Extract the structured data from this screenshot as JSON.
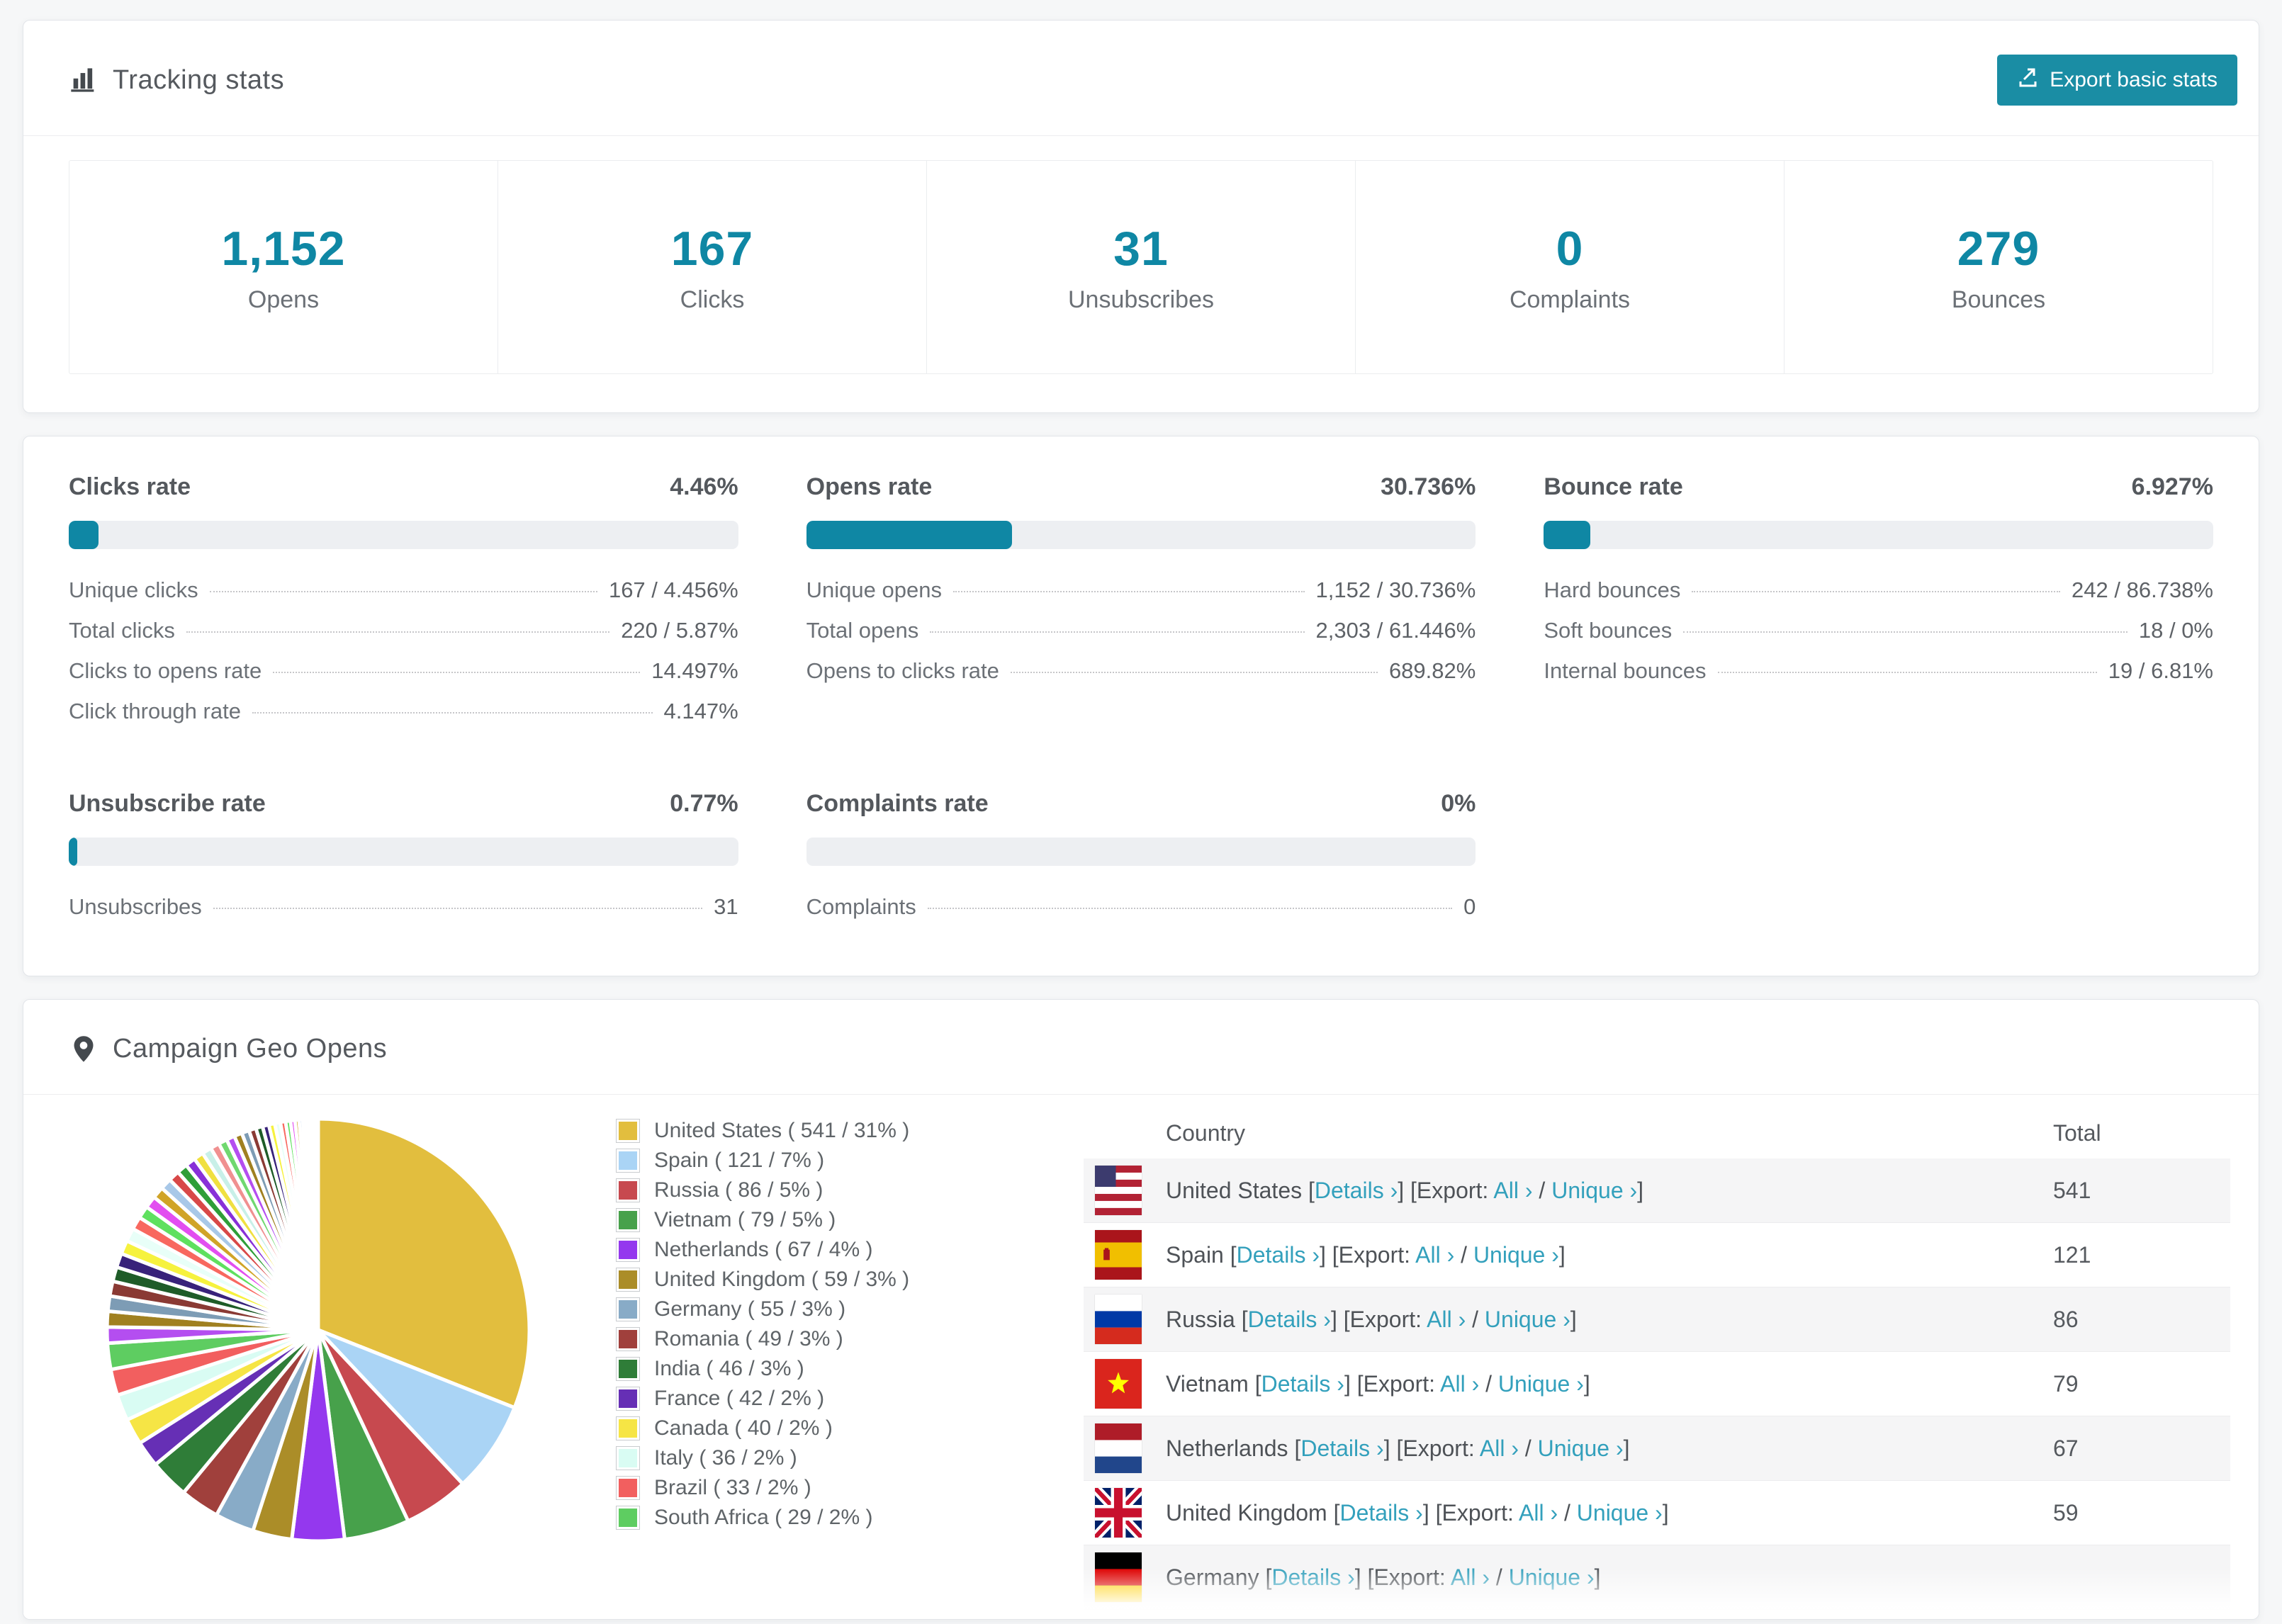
{
  "colors": {
    "accent_teal": "#0f87a4",
    "button_teal": "#1a8da4",
    "link_teal": "#33a0bc",
    "page_bg": "#f6f7f8",
    "track_gray": "#edeff2",
    "row_stripe": "#f5f5f6"
  },
  "tracking": {
    "title": "Tracking stats",
    "export_label": "Export basic stats",
    "stats": [
      {
        "value": "1,152",
        "label": "Opens"
      },
      {
        "value": "167",
        "label": "Clicks"
      },
      {
        "value": "31",
        "label": "Unsubscribes"
      },
      {
        "value": "0",
        "label": "Complaints"
      },
      {
        "value": "279",
        "label": "Bounces"
      }
    ]
  },
  "rates": {
    "sections": [
      {
        "title": "Clicks rate",
        "value": "4.46%",
        "percent": 4.46,
        "rows": [
          {
            "label": "Unique clicks",
            "value": "167 / 4.456%"
          },
          {
            "label": "Total clicks",
            "value": "220 / 5.87%"
          },
          {
            "label": "Clicks to opens rate",
            "value": "14.497%"
          },
          {
            "label": "Click through rate",
            "value": "4.147%"
          }
        ]
      },
      {
        "title": "Opens rate",
        "value": "30.736%",
        "percent": 30.736,
        "rows": [
          {
            "label": "Unique opens",
            "value": "1,152 / 30.736%"
          },
          {
            "label": "Total opens",
            "value": "2,303 / 61.446%"
          },
          {
            "label": "Opens to clicks rate",
            "value": "689.82%"
          }
        ]
      },
      {
        "title": "Bounce rate",
        "value": "6.927%",
        "percent": 6.927,
        "rows": [
          {
            "label": "Hard bounces",
            "value": "242 / 86.738%"
          },
          {
            "label": "Soft bounces",
            "value": "18 / 0%"
          },
          {
            "label": "Internal bounces",
            "value": "19 / 6.81%"
          }
        ]
      },
      {
        "title": "Unsubscribe rate",
        "value": "0.77%",
        "percent": 0.77,
        "rows": [
          {
            "label": "Unsubscribes",
            "value": "31"
          }
        ]
      },
      {
        "title": "Complaints rate",
        "value": "0%",
        "percent": 0,
        "rows": [
          {
            "label": "Complaints",
            "value": "0"
          }
        ]
      }
    ]
  },
  "geo": {
    "title": "Campaign Geo Opens",
    "legend": [
      {
        "label": "United States ( 541 / 31% )",
        "color": "#e2be3e"
      },
      {
        "label": "Spain ( 121 / 7% )",
        "color": "#aad4f5"
      },
      {
        "label": "Russia ( 86 / 5% )",
        "color": "#c7494f"
      },
      {
        "label": "Vietnam ( 79 / 5% )",
        "color": "#47a14b"
      },
      {
        "label": "Netherlands ( 67 / 4% )",
        "color": "#9438ee"
      },
      {
        "label": "United Kingdom ( 59 / 3% )",
        "color": "#ab8d28"
      },
      {
        "label": "Germany ( 55 / 3% )",
        "color": "#88abc7"
      },
      {
        "label": "Romania ( 49 / 3% )",
        "color": "#a0403c"
      },
      {
        "label": "India ( 46 / 3% )",
        "color": "#2f7d38"
      },
      {
        "label": "France ( 42 / 2% )",
        "color": "#662fb5"
      },
      {
        "label": "Canada ( 40 / 2% )",
        "color": "#f6e545"
      },
      {
        "label": "Italy ( 36 / 2% )",
        "color": "#d9fcf3"
      },
      {
        "label": "Brazil ( 33 / 2% )",
        "color": "#f25f5f"
      },
      {
        "label": "South Africa ( 29 / 2% )",
        "color": "#5ecd61"
      }
    ],
    "table": {
      "col_country": "Country",
      "col_total": "Total",
      "links": {
        "bracket_open": "[",
        "bracket_close": "]",
        "details": "Details ›",
        "export_prefix": "[Export:",
        "all": "All ›",
        "slash": "/",
        "unique": "Unique ›"
      },
      "rows": [
        {
          "flag": "us",
          "country": "United States",
          "total": "541",
          "partial": false
        },
        {
          "flag": "es",
          "country": "Spain",
          "total": "121",
          "partial": false
        },
        {
          "flag": "ru",
          "country": "Russia",
          "total": "86",
          "partial": false
        },
        {
          "flag": "vn",
          "country": "Vietnam",
          "total": "79",
          "partial": false
        },
        {
          "flag": "nl",
          "country": "Netherlands",
          "total": "67",
          "partial": false
        },
        {
          "flag": "gb",
          "country": "United Kingdom",
          "total": "59",
          "partial": false
        },
        {
          "flag": "de",
          "country": "Germany",
          "total": "",
          "partial": true
        }
      ]
    }
  },
  "chart_data": {
    "type": "pie",
    "title": "Campaign Geo Opens",
    "legend_position": "right",
    "start_angle_deg": -90,
    "direction": "clockwise",
    "slices": [
      {
        "label": "United States",
        "value": 541,
        "pct": 31,
        "color": "#e2be3e"
      },
      {
        "label": "Spain",
        "value": 121,
        "pct": 7,
        "color": "#aad4f5"
      },
      {
        "label": "Russia",
        "value": 86,
        "pct": 5,
        "color": "#c7494f"
      },
      {
        "label": "Vietnam",
        "value": 79,
        "pct": 5,
        "color": "#47a14b"
      },
      {
        "label": "Netherlands",
        "value": 67,
        "pct": 4,
        "color": "#9438ee"
      },
      {
        "label": "United Kingdom",
        "value": 59,
        "pct": 3,
        "color": "#ab8d28"
      },
      {
        "label": "Germany",
        "value": 55,
        "pct": 3,
        "color": "#88abc7"
      },
      {
        "label": "Romania",
        "value": 49,
        "pct": 3,
        "color": "#a0403c"
      },
      {
        "label": "India",
        "value": 46,
        "pct": 3,
        "color": "#2f7d38"
      },
      {
        "label": "France",
        "value": 42,
        "pct": 2,
        "color": "#662fb5"
      },
      {
        "label": "Canada",
        "value": 40,
        "pct": 2,
        "color": "#f6e545"
      },
      {
        "label": "Italy",
        "value": 36,
        "pct": 2,
        "color": "#d9fcf3"
      },
      {
        "label": "Brazil",
        "value": 33,
        "pct": 2,
        "color": "#f25f5f"
      },
      {
        "label": "South Africa",
        "value": 29,
        "pct": 2,
        "color": "#5ecd61"
      }
    ],
    "other_slices": {
      "note": "many small unlabeled countries filling remaining share",
      "pct_total": 26,
      "values": [
        1.25,
        1.22,
        1.19,
        1.16,
        1.13,
        1.1,
        1.07,
        1.04,
        1.01,
        0.98,
        0.95,
        0.92,
        0.89,
        0.86,
        0.83,
        0.8,
        0.77,
        0.74,
        0.71,
        0.68,
        0.65,
        0.62,
        0.59,
        0.56,
        0.53,
        0.5,
        0.47,
        0.44,
        0.41,
        0.38,
        0.35,
        0.32,
        0.29,
        0.26,
        0.23,
        0.2,
        0.17,
        0.14,
        0.11,
        0.08
      ],
      "palette": [
        "#b44ef0",
        "#a08020",
        "#7d9cb5",
        "#8a3a34",
        "#1e5c28",
        "#38227a",
        "#f6f23e",
        "#e8fff8",
        "#f8685f",
        "#5fe05f",
        "#e24ef0",
        "#d0a428",
        "#a8c8e8",
        "#d84848",
        "#2f9e38",
        "#8830d8",
        "#f0e040",
        "#c8f0e8",
        "#f09090",
        "#70d870"
      ]
    }
  }
}
